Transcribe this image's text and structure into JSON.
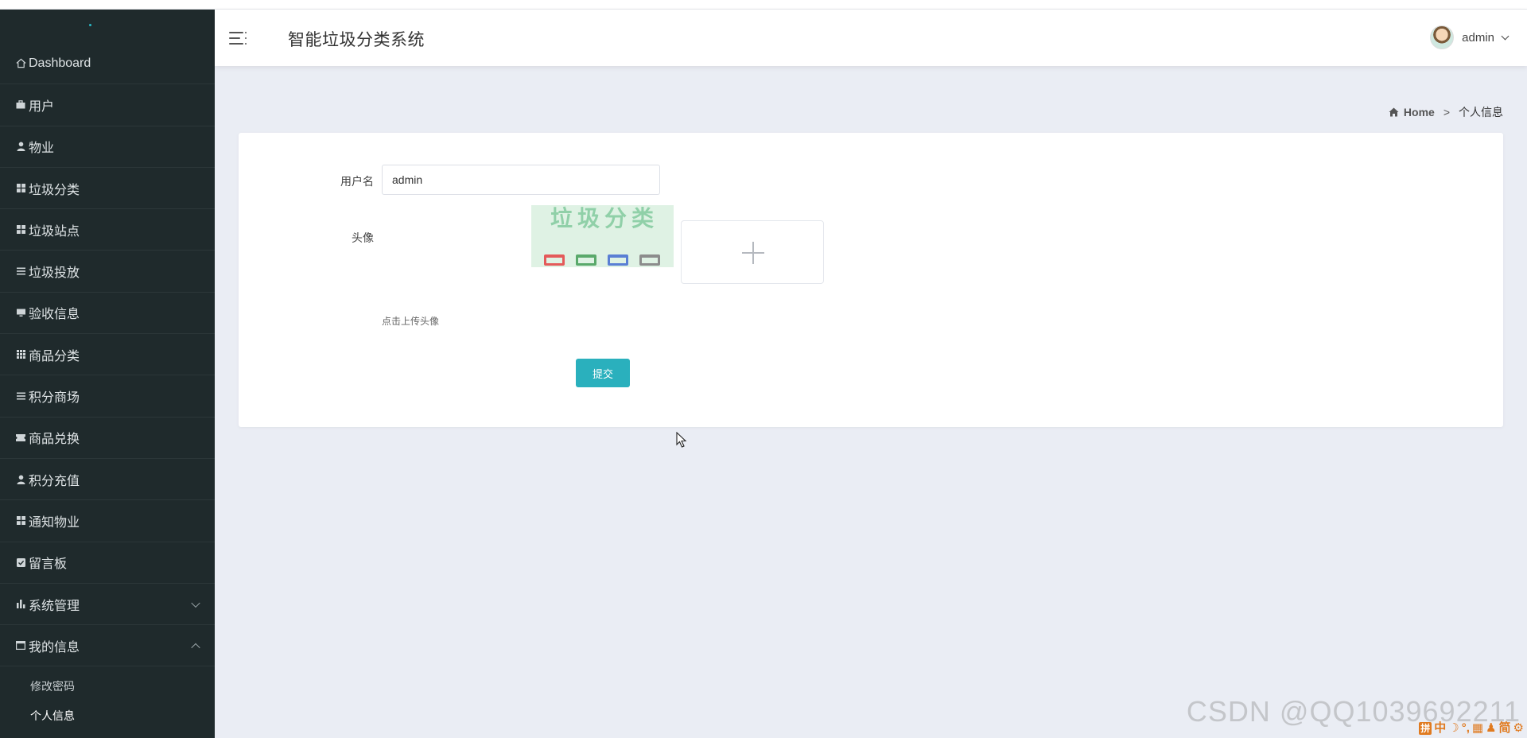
{
  "app": {
    "title": "智能垃圾分类系统"
  },
  "header": {
    "user_name": "admin"
  },
  "sidebar": {
    "items": [
      {
        "label": "Dashboard",
        "icon": "home-icon"
      },
      {
        "label": "用户",
        "icon": "briefcase-icon"
      },
      {
        "label": "物业",
        "icon": "user-icon"
      },
      {
        "label": "垃圾分类",
        "icon": "grid-icon"
      },
      {
        "label": "垃圾站点",
        "icon": "grid-icon"
      },
      {
        "label": "垃圾投放",
        "icon": "list-icon"
      },
      {
        "label": "验收信息",
        "icon": "monitor-icon"
      },
      {
        "label": "商品分类",
        "icon": "grid-icon"
      },
      {
        "label": "积分商场",
        "icon": "list-icon"
      },
      {
        "label": "商品兑换",
        "icon": "ticket-icon"
      },
      {
        "label": "积分充值",
        "icon": "user-icon"
      },
      {
        "label": "通知物业",
        "icon": "grid-icon"
      },
      {
        "label": "留言板",
        "icon": "check-square-icon"
      },
      {
        "label": "系统管理",
        "icon": "bar-chart-icon"
      },
      {
        "label": "我的信息",
        "icon": "window-icon"
      }
    ],
    "submenu": [
      {
        "label": "修改密码"
      },
      {
        "label": "个人信息"
      }
    ]
  },
  "breadcrumb": {
    "home": "Home",
    "separator": ">",
    "current": "个人信息"
  },
  "form": {
    "username_label": "用户名",
    "username_value": "admin",
    "avatar_label": "头像",
    "avatar_text": "垃圾分类",
    "upload_hint": "点击上传头像",
    "submit_label": "提交"
  },
  "watermark": {
    "text": "CSDN @QQ1039692211"
  },
  "ime": {
    "items": [
      "拼",
      "中",
      "☽",
      "°,",
      "▦",
      "♟",
      "简",
      "⚙"
    ]
  },
  "colors": {
    "sidebar_bg": "#1f2a2c",
    "accent": "#2ab0bd",
    "page_bg": "#eaedf4"
  }
}
